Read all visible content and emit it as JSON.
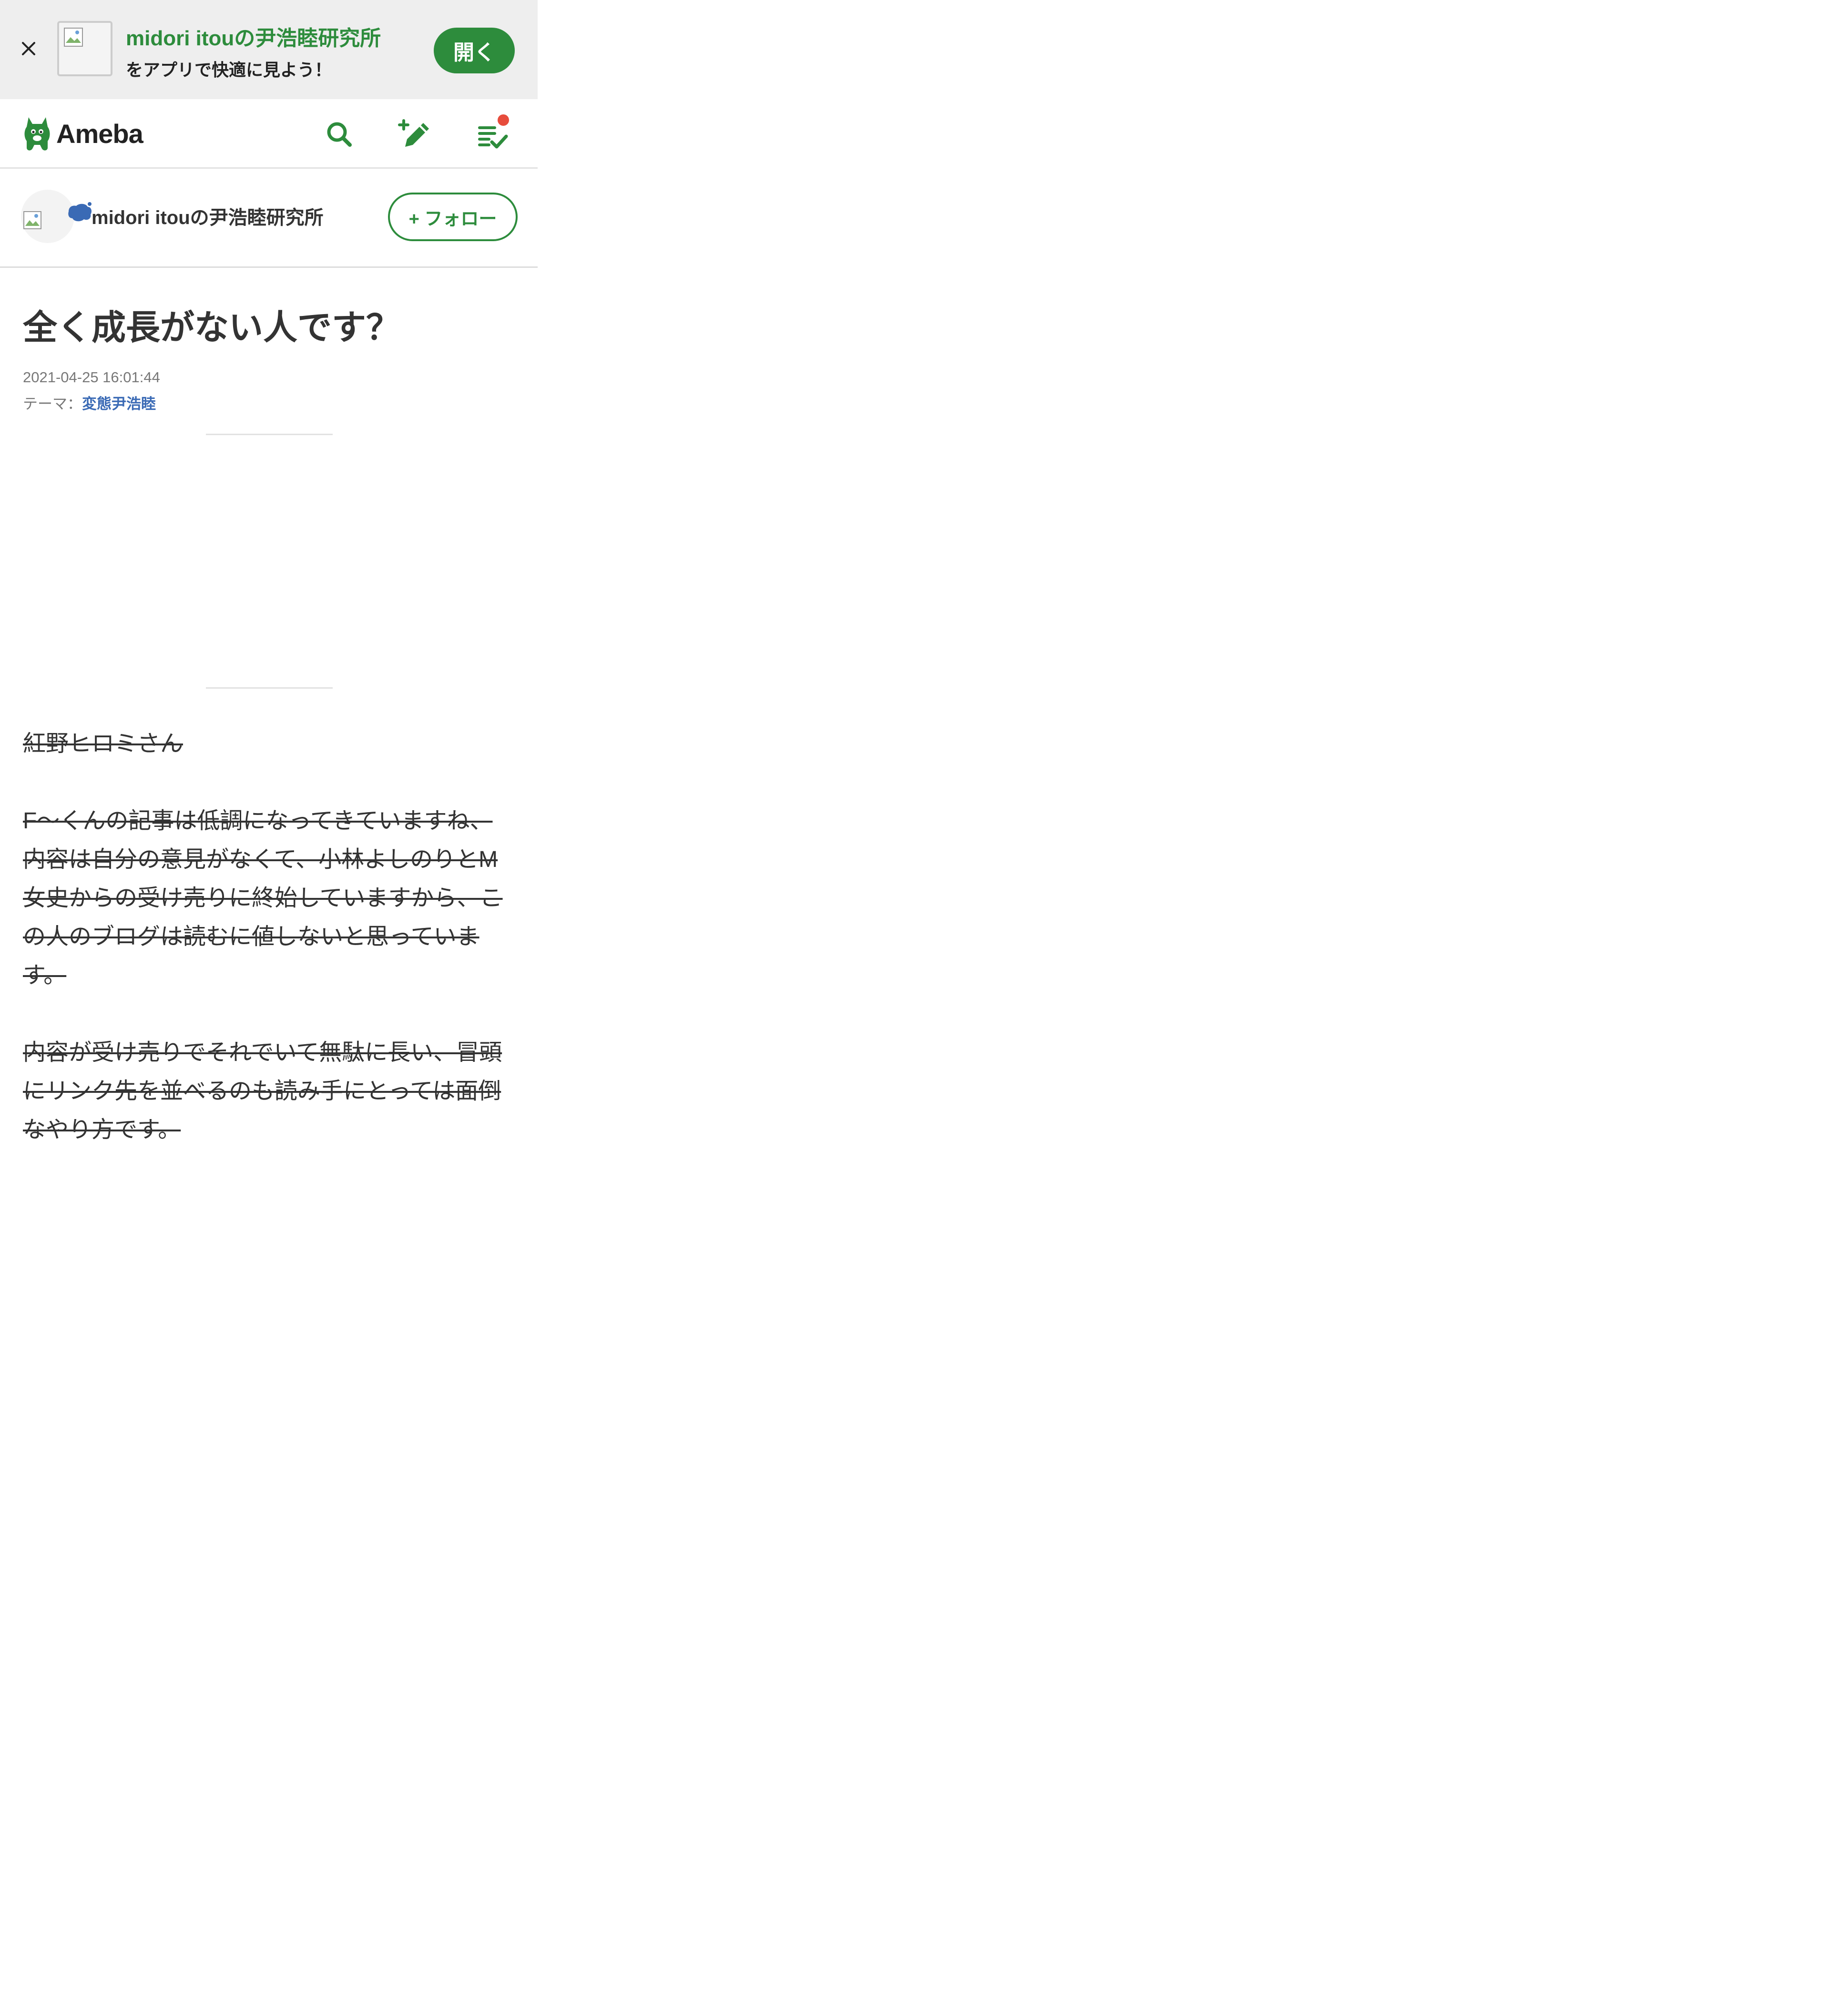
{
  "app_banner": {
    "title": "midori itouの尹浩睦研究所",
    "subtitle": "をアプリで快適に見よう！",
    "open_label": "開く",
    "close_icon": "close-icon"
  },
  "header": {
    "logo_text": "Ameba",
    "icons": [
      "search-icon",
      "write-post-icon",
      "feed-check-icon"
    ]
  },
  "blog": {
    "name": "midori itouの尹浩睦研究所",
    "follow_label": "+ フォロー"
  },
  "article": {
    "title": "全く成長がない人です？",
    "date": "2021-04-25 16:01:44",
    "theme_label": "テーマ：",
    "theme_value": "変態尹浩睦",
    "paragraphs": [
      [
        "紅野ヒロミさん"
      ],
      [
        "F～くんの記事は低調になってきていますね、",
        "内容は自分の意見がなくて、小林よしのりとM",
        "女史からの受け売りに終始していますから、こ",
        "の人のブログは読むに値しないと思っていま",
        "す。"
      ],
      [
        "内容が受け売りでそれでいて無駄に長い、冒頭",
        "にリンク先を並べるのも読み手にとっては面倒",
        "なやり方です。"
      ]
    ]
  },
  "colors": {
    "brand_green": "#2d8c3c",
    "notify_red": "#e74c3c",
    "link_blue": "#3a6ab5"
  }
}
